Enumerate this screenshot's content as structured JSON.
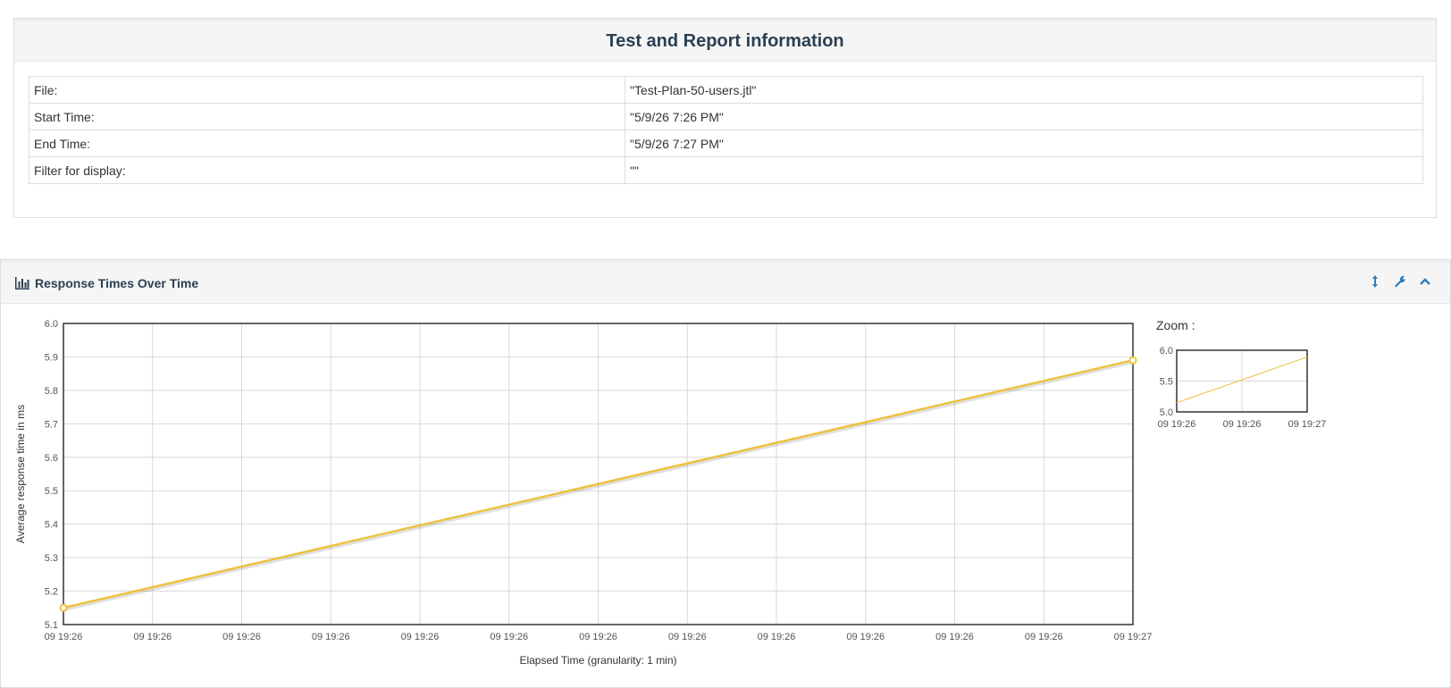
{
  "info": {
    "title": "Test and Report information",
    "rows": [
      {
        "key": "File:",
        "value": "\"Test-Plan-50-users.jtl\""
      },
      {
        "key": "Start Time:",
        "value": "\"5/9/26 7:26 PM\""
      },
      {
        "key": "End Time:",
        "value": "\"5/9/26 7:27 PM\""
      },
      {
        "key": "Filter for display:",
        "value": "\"\""
      }
    ]
  },
  "chart_panel": {
    "title": "Response Times Over Time",
    "icons": [
      "bar-chart-icon",
      "resize-vertical-icon",
      "wrench-icon",
      "chevron-up-icon"
    ],
    "zoom_label": "Zoom :"
  },
  "chart_data": {
    "type": "line",
    "xlabel": "Elapsed Time (granularity: 1 min)",
    "ylabel": "Average response time in ms",
    "ylim": [
      5.1,
      6.0
    ],
    "yticks": [
      "5.1",
      "5.2",
      "5.3",
      "5.4",
      "5.5",
      "5.6",
      "5.7",
      "5.8",
      "5.9",
      "6.0"
    ],
    "xticks": [
      "09 19:26",
      "09 19:26",
      "09 19:26",
      "09 19:26",
      "09 19:26",
      "09 19:26",
      "09 19:26",
      "09 19:26",
      "09 19:26",
      "09 19:26",
      "09 19:26",
      "09 19:26",
      "09 19:27"
    ],
    "grid": true,
    "series": [
      {
        "color": "#edc240",
        "x": [
          "09 19:26",
          "09 19:27"
        ],
        "values": [
          5.15,
          5.89
        ]
      }
    ],
    "zoom": {
      "ylim": [
        5.0,
        6.0
      ],
      "yticks": [
        "5.0",
        "5.5",
        "6.0"
      ],
      "xticks": [
        "09 19:26",
        "09 19:26",
        "09 19:27"
      ]
    }
  }
}
